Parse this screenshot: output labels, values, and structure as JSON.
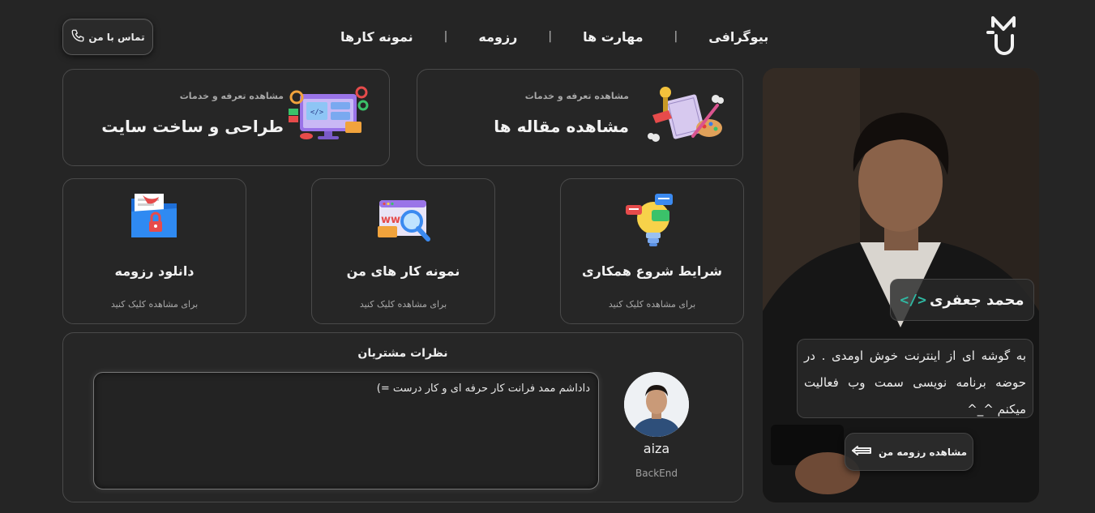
{
  "nav": {
    "links": [
      "بیوگرافی",
      "مهارت ها",
      "رزومه",
      "نمونه کارها"
    ],
    "contact_label": "تماس با من"
  },
  "services": [
    {
      "subtitle": "مشاهده تعرفه و خدمات",
      "title": "مشاهده مقاله ها"
    },
    {
      "subtitle": "مشاهده تعرفه و خدمات",
      "title": "طراحی و ساخت سایت"
    }
  ],
  "quick_links": [
    {
      "title": "شرایط شروع همکاری",
      "subtitle": "برای مشاهده کلیک کنید",
      "icon": "idea-bulb-icon"
    },
    {
      "title": "نمونه کار های من",
      "subtitle": "برای مشاهده کلیک کنید",
      "icon": "www-search-icon"
    },
    {
      "title": "دانلود رزومه",
      "subtitle": "برای مشاهده کلیک کنید",
      "icon": "locked-folder-icon"
    }
  ],
  "testimonials": {
    "title": "نظرات مشتریان",
    "items": [
      {
        "text": "داداشم ممد فرانت کار حرفه ای و کار درست =)",
        "name": "aiza",
        "role": "BackEnd"
      }
    ]
  },
  "profile": {
    "name": "محمد جعفری",
    "code_tag": "</>",
    "bio": "به گوشه ای از اینترنت خوش اومدی . در حوضه برنامه نویسی سمت وب فعالیت میکنم ^_^",
    "resume_label": "مشاهده رزومه من"
  },
  "colors": {
    "background": "#252525",
    "accent": "#2fb8a2",
    "card_border": "#4a4a4a"
  }
}
